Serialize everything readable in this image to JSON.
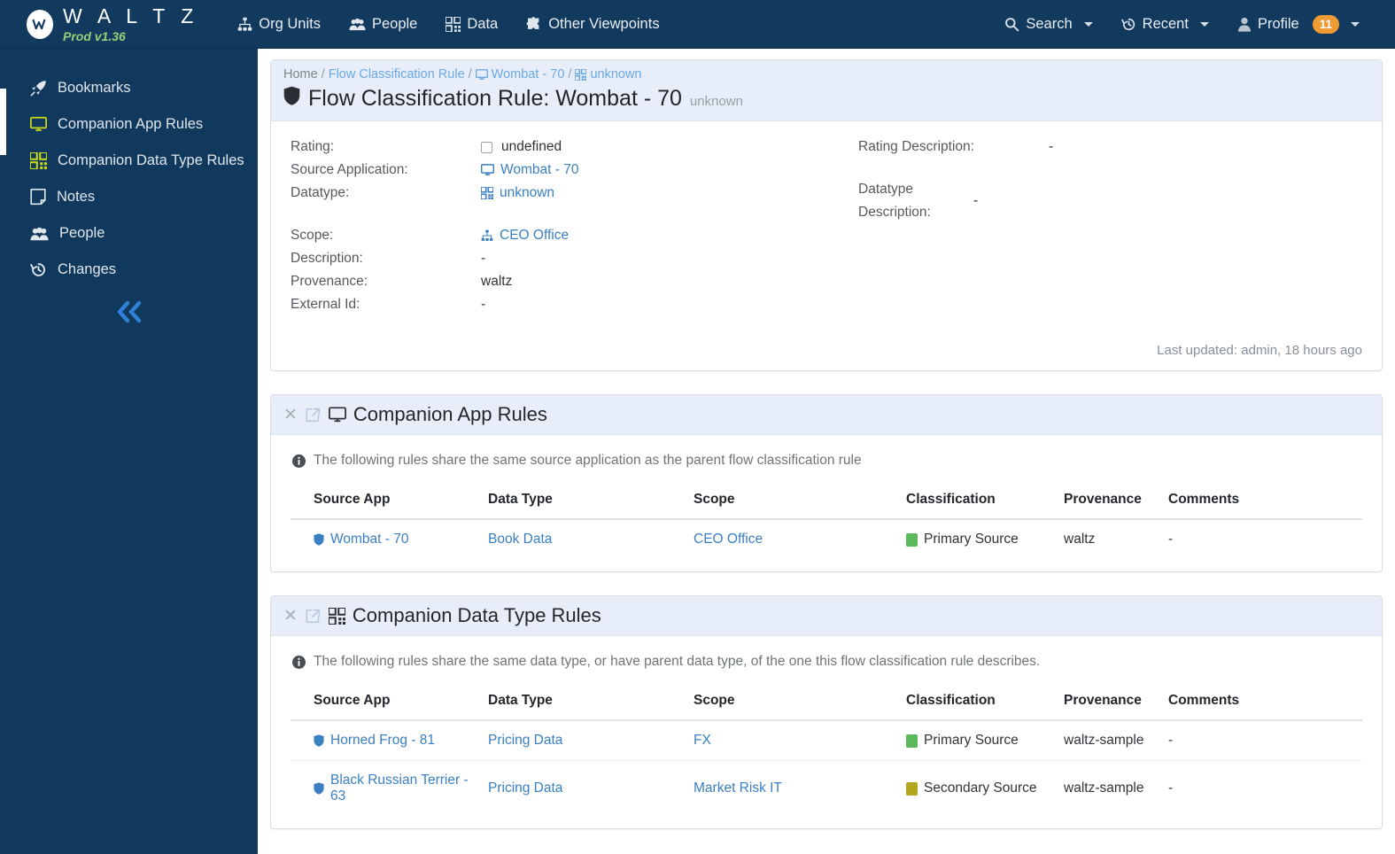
{
  "navbar": {
    "brand": {
      "mark": "w",
      "title": "W A L T Z",
      "version": "Prod v1.36"
    },
    "items": [
      {
        "label": "Org Units",
        "icon": "sitemap-icon"
      },
      {
        "label": "People",
        "icon": "people-icon"
      },
      {
        "label": "Data",
        "icon": "qrcode-icon"
      },
      {
        "label": "Other Viewpoints",
        "icon": "puzzle-piece-icon"
      }
    ],
    "right": [
      {
        "label": "Search",
        "icon": "search-icon",
        "caret": true
      },
      {
        "label": "Recent",
        "icon": "history-icon",
        "caret": true
      },
      {
        "label": "Profile",
        "icon": "user-icon",
        "badge": "11",
        "caret": true
      }
    ]
  },
  "sidebar": {
    "items": [
      {
        "label": "Bookmarks",
        "icon": "rocket-icon",
        "active": false
      },
      {
        "label": "Companion App Rules",
        "icon": "desktop-icon",
        "active": true
      },
      {
        "label": "Companion Data Type Rules",
        "icon": "qrcode-icon",
        "active": true
      },
      {
        "label": "Notes",
        "icon": "note-icon",
        "active": false
      },
      {
        "label": "People",
        "icon": "people-icon",
        "active": false
      },
      {
        "label": "Changes",
        "icon": "history-icon",
        "active": false
      }
    ],
    "collapse_icon": "double-chevron-left-icon"
  },
  "header": {
    "breadcrumb": [
      {
        "label": "Home",
        "link": false,
        "icon": null
      },
      {
        "label": "Flow Classification Rule",
        "link": true,
        "icon": null
      },
      {
        "label": "Wombat - 70",
        "link": true,
        "icon": "desktop-icon"
      },
      {
        "label": "unknown",
        "link": true,
        "icon": "qrcode-icon"
      }
    ],
    "title": "Flow Classification Rule: Wombat - 70",
    "title_icon": "shield-icon",
    "title_sub": "unknown"
  },
  "detail": {
    "left": [
      {
        "label": "Rating:",
        "value": "undefined",
        "type": "checkbox"
      },
      {
        "label": "Source Application:",
        "value": "Wombat - 70",
        "type": "link",
        "icon": "desktop-icon"
      },
      {
        "label": "Datatype:",
        "value": "unknown",
        "type": "link",
        "icon": "qrcode-icon"
      },
      {
        "label": "",
        "value": "",
        "type": "spacer"
      },
      {
        "label": "Scope:",
        "value": "CEO Office",
        "type": "link",
        "icon": "sitemap-icon"
      },
      {
        "label": "Description:",
        "value": "-",
        "type": "text"
      },
      {
        "label": "Provenance:",
        "value": "waltz",
        "type": "text"
      },
      {
        "label": "External Id:",
        "value": "-",
        "type": "text"
      }
    ],
    "right": [
      {
        "label": "Rating Description:",
        "value": "-",
        "type": "text"
      },
      {
        "label": "",
        "value": "",
        "type": "spacer"
      },
      {
        "label": "Datatype Description:",
        "value": "-",
        "type": "text"
      }
    ],
    "last_updated": "Last updated: admin, 18 hours ago"
  },
  "sections": [
    {
      "title": "Companion App Rules",
      "icon": "desktop-icon",
      "close_icon": "close-icon",
      "popout_icon": "external-link-icon",
      "note": "The following rules share the same source application as the parent flow classification rule",
      "note_icon": "info-icon",
      "columns": [
        "Source App",
        "Data Type",
        "Scope",
        "Classification",
        "Provenance",
        "Comments"
      ],
      "rows": [
        {
          "source_app": "Wombat - 70",
          "source_app_icon": "shield-icon",
          "data_type": "Book Data",
          "scope": "CEO Office",
          "classification": "Primary Source",
          "classification_color": "#5cb85c",
          "provenance": "waltz",
          "comments": "-"
        }
      ]
    },
    {
      "title": "Companion Data Type Rules",
      "icon": "qrcode-icon",
      "close_icon": "close-icon",
      "popout_icon": "external-link-icon",
      "note": "The following rules share the same data type, or have parent data type, of the one this flow classification rule describes.",
      "note_icon": "info-icon",
      "columns": [
        "Source App",
        "Data Type",
        "Scope",
        "Classification",
        "Provenance",
        "Comments"
      ],
      "rows": [
        {
          "source_app": "Horned Frog - 81",
          "source_app_icon": "shield-icon",
          "data_type": "Pricing Data",
          "scope": "FX",
          "classification": "Primary Source",
          "classification_color": "#5cb85c",
          "provenance": "waltz-sample",
          "comments": "-"
        },
        {
          "source_app": "Black Russian Terrier - 63",
          "source_app_icon": "shield-icon",
          "data_type": "Pricing Data",
          "scope": "Market Risk IT",
          "classification": "Secondary Source",
          "classification_color": "#b3a81d",
          "provenance": "waltz-sample",
          "comments": "-"
        }
      ]
    }
  ],
  "colors": {
    "navy": "#12395e",
    "link": "#3a7fc1",
    "panel_head": "#e7eefa",
    "accent_yellow_green": "#c9d916",
    "badge_orange": "#ef9a33",
    "primary_source": "#5cb85c",
    "secondary_source": "#b3a81d"
  }
}
